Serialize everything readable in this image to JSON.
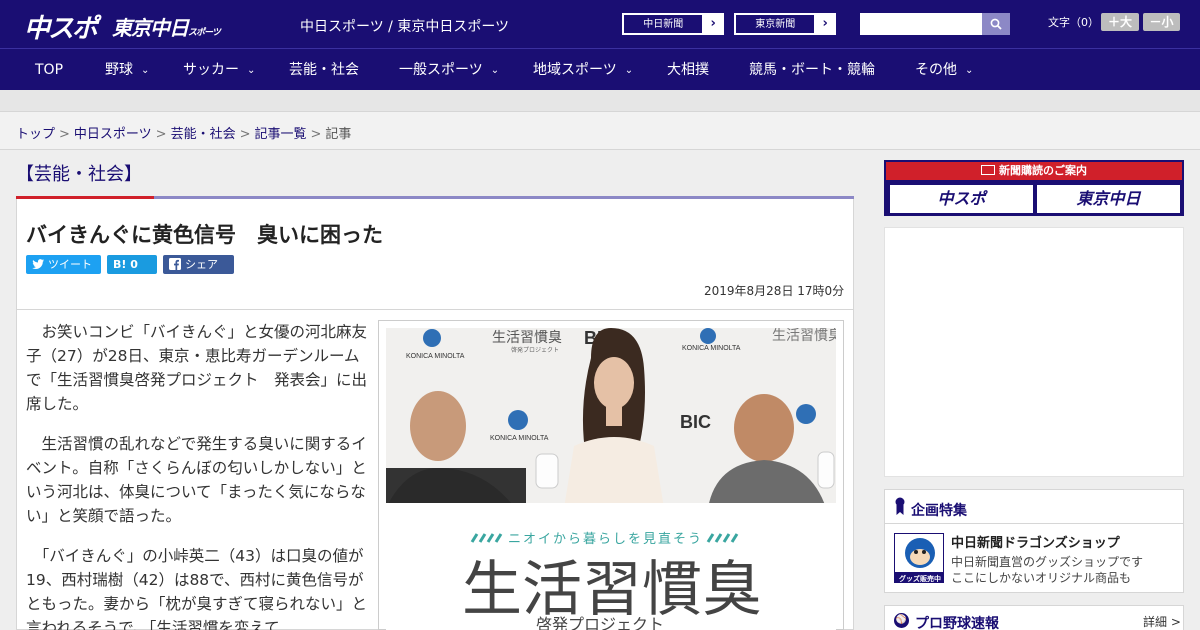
{
  "header": {
    "logo_chunichi_sports": "中スポ",
    "logo_tokyo_chunichi": "東京中日",
    "logo_tokyo_suffix": "スポーツ",
    "site_title": "中日スポーツ / 東京中日スポーツ",
    "ext_links": [
      {
        "label": "中日新聞",
        "arrow": "›"
      },
      {
        "label": "東京新聞",
        "arrow": "›"
      }
    ],
    "search_placeholder": "",
    "search_icon": "search-icon",
    "font_size_label": "文字（0）",
    "font_larger": "＋大",
    "font_smaller": "－小"
  },
  "nav": {
    "items": [
      {
        "label": "TOP",
        "chevron": ""
      },
      {
        "label": "野球",
        "chevron": "⌄"
      },
      {
        "label": "サッカー",
        "chevron": "⌄"
      },
      {
        "label": "芸能・社会",
        "chevron": ""
      },
      {
        "label": "一般スポーツ",
        "chevron": "⌄"
      },
      {
        "label": "地域スポーツ",
        "chevron": "⌄"
      },
      {
        "label": "大相撲",
        "chevron": ""
      },
      {
        "label": "競馬・ボート・競輪",
        "chevron": ""
      },
      {
        "label": "その他",
        "chevron": "⌄"
      }
    ]
  },
  "breadcrumb": {
    "items": [
      "トップ",
      "中日スポーツ",
      "芸能・社会",
      "記事一覧",
      "記事"
    ],
    "separator": ">"
  },
  "article": {
    "section": "【芸能・社会】",
    "headline": "バイきんぐに黄色信号　臭いに困った",
    "share": {
      "tweet": "ツイート",
      "hatena": "B!  0",
      "facebook": "シェア 0"
    },
    "date": "2019年8月28日 17時0分",
    "paragraphs": [
      "　お笑いコンビ「バイきんぐ」と女優の河北麻友子（27）が28日、東京・恵比寿ガーデンルームで「生活習慣臭啓発プロジェクト　発表会」に出席した。",
      "　生活習慣の乱れなどで発生する臭いに関するイベント。自称「さくらんぼの匂いしかしない」という河北は、体臭について「まったく気にならない」と笑顔で語った。",
      "　「バイきんぐ」の小峠英二（43）は口臭の値が19、西村瑞樹（42）は88で、西村に黄色信号がともった。妻から「枕が臭すぎて寝られない」と言われるそうで、「生活習慣を変えて"
    ],
    "photo": {
      "backdrop_brand": "KONICA MINOLTA",
      "backdrop_title": "生活習慣臭",
      "backdrop_sub": "啓発プロジェクト",
      "bic_label": "BIC",
      "banner_tagline": "ニオイから暮らしを見直そう",
      "banner_title": "生活習慣臭",
      "banner_sub": "啓発プロジェクト"
    }
  },
  "sidebar": {
    "subscription": {
      "heading": "新聞購読のご案内",
      "logos": [
        "中スポ",
        "東京中日"
      ]
    },
    "featured": {
      "title": "企画特集",
      "shop_title": "中日新聞ドラゴンズショップ",
      "shop_desc_1": "中日新聞直営のグッズショップです",
      "shop_desc_2": "ここにしかないオリジナル商品も",
      "shop_badge": "グッズ販売中"
    },
    "baseball": {
      "title": "プロ野球速報",
      "more": "詳細 >"
    }
  },
  "colors": {
    "brand_navy": "#1a0e73",
    "accent_red": "#d0202a",
    "rule_purple": "#8c88c6"
  }
}
